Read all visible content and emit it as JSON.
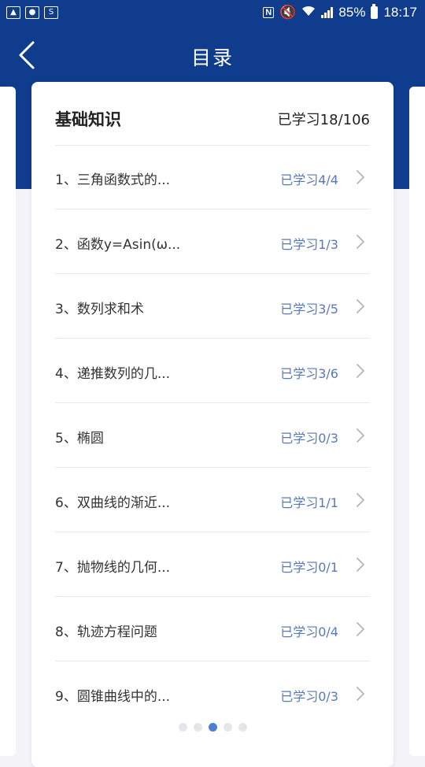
{
  "status_bar": {
    "battery": "85%",
    "time": "18:17"
  },
  "header": {
    "title": "目录"
  },
  "section": {
    "title": "基础知识",
    "progress": "已学习18/106"
  },
  "items": [
    {
      "label": "1、三角函数式的...",
      "progress": "已学习4/4"
    },
    {
      "label": "2、函数y=Asin(ω...",
      "progress": "已学习1/3"
    },
    {
      "label": "3、数列求和术",
      "progress": "已学习3/5"
    },
    {
      "label": "4、递推数列的几...",
      "progress": "已学习3/6"
    },
    {
      "label": "5、椭圆",
      "progress": "已学习0/3"
    },
    {
      "label": "6、双曲线的渐近...",
      "progress": "已学习1/1"
    },
    {
      "label": "7、抛物线的几何...",
      "progress": "已学习0/1"
    },
    {
      "label": "8、轨迹方程问题",
      "progress": "已学习0/4"
    },
    {
      "label": "9、圆锥曲线中的...",
      "progress": "已学习0/3"
    }
  ],
  "pager": {
    "count": 5,
    "active_index": 2
  },
  "colors": {
    "header_blue": "#0f3c8c",
    "progress_text": "#5a79b8",
    "active_dot": "#4f7fd4"
  }
}
